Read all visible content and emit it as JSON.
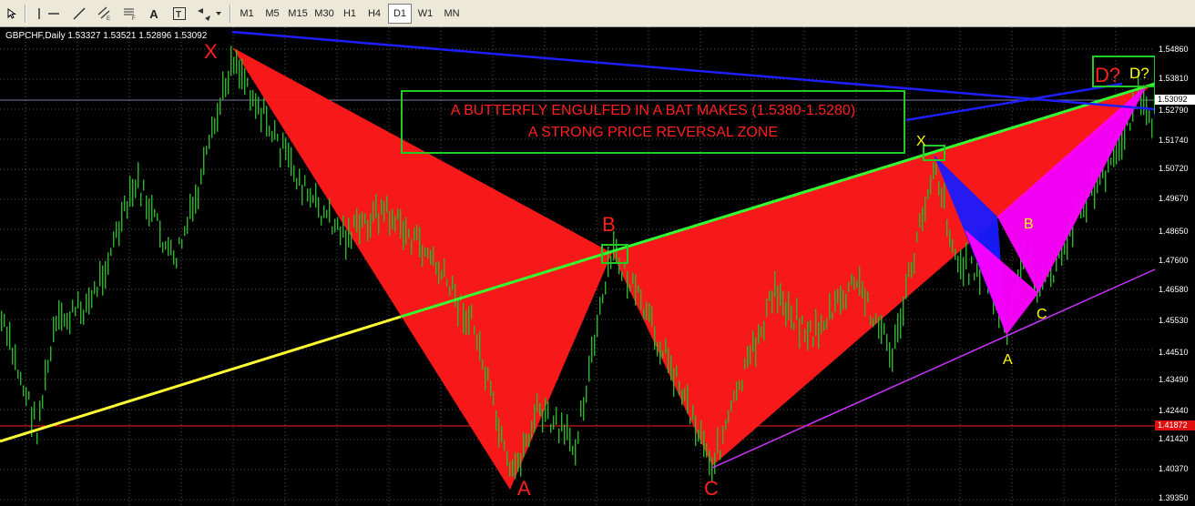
{
  "toolbar": {
    "tools": [
      "cursor-tool",
      "vertical-line-tool",
      "horizontal-line-tool",
      "trendline-tool",
      "equidistant-channel-tool",
      "fibonacci-retracement-tool",
      "text-tool",
      "text-label-tool",
      "arrows-tool"
    ],
    "text_tool_label": "A",
    "timeframes": [
      "M1",
      "M5",
      "M15",
      "M30",
      "H1",
      "H4",
      "D1",
      "W1",
      "MN"
    ],
    "active_timeframe": "D1"
  },
  "chart": {
    "title": "GBPCHF,Daily  1.53327 1.53521 1.52896 1.53092",
    "price_axis": [
      "1.54860",
      "1.53810",
      "1.52790",
      "1.51740",
      "1.50720",
      "1.49670",
      "1.48650",
      "1.47600",
      "1.46580",
      "1.45530",
      "1.44510",
      "1.43490",
      "1.42440",
      "1.41420",
      "1.40370",
      "1.39350"
    ],
    "price_range": [
      1.3935,
      1.556
    ],
    "current_price_tag": "1.53092",
    "level_tag": "1.41872",
    "bat_points": {
      "x": "X",
      "a": "A",
      "b": "B",
      "c": "C",
      "d": "D?"
    },
    "butterfly_points": {
      "x": "X",
      "a": "A",
      "b": "B",
      "c": "C",
      "d": "D?"
    },
    "annotation": {
      "line1": "A BUTTERFLY ENGULFED IN A BAT MAKES (1.5380-1.5280)",
      "line2": "A STRONG PRICE REVERSAL ZONE"
    },
    "colors": {
      "background": "#000000",
      "candles": "#2db52d",
      "bat_pattern": "#ff1a1a",
      "butterfly_blue": "#1a1aff",
      "butterfly_pattern": "#ff00ff",
      "trendline_green": "#33ff33",
      "trendline_yellow": "#ffff33",
      "trendline_blue": "#1e1eff",
      "support_line": "#cc33ff",
      "annotation_box": "#22cc22",
      "bat_labels": "#ff2020",
      "butterfly_labels": "#ffff00"
    }
  }
}
